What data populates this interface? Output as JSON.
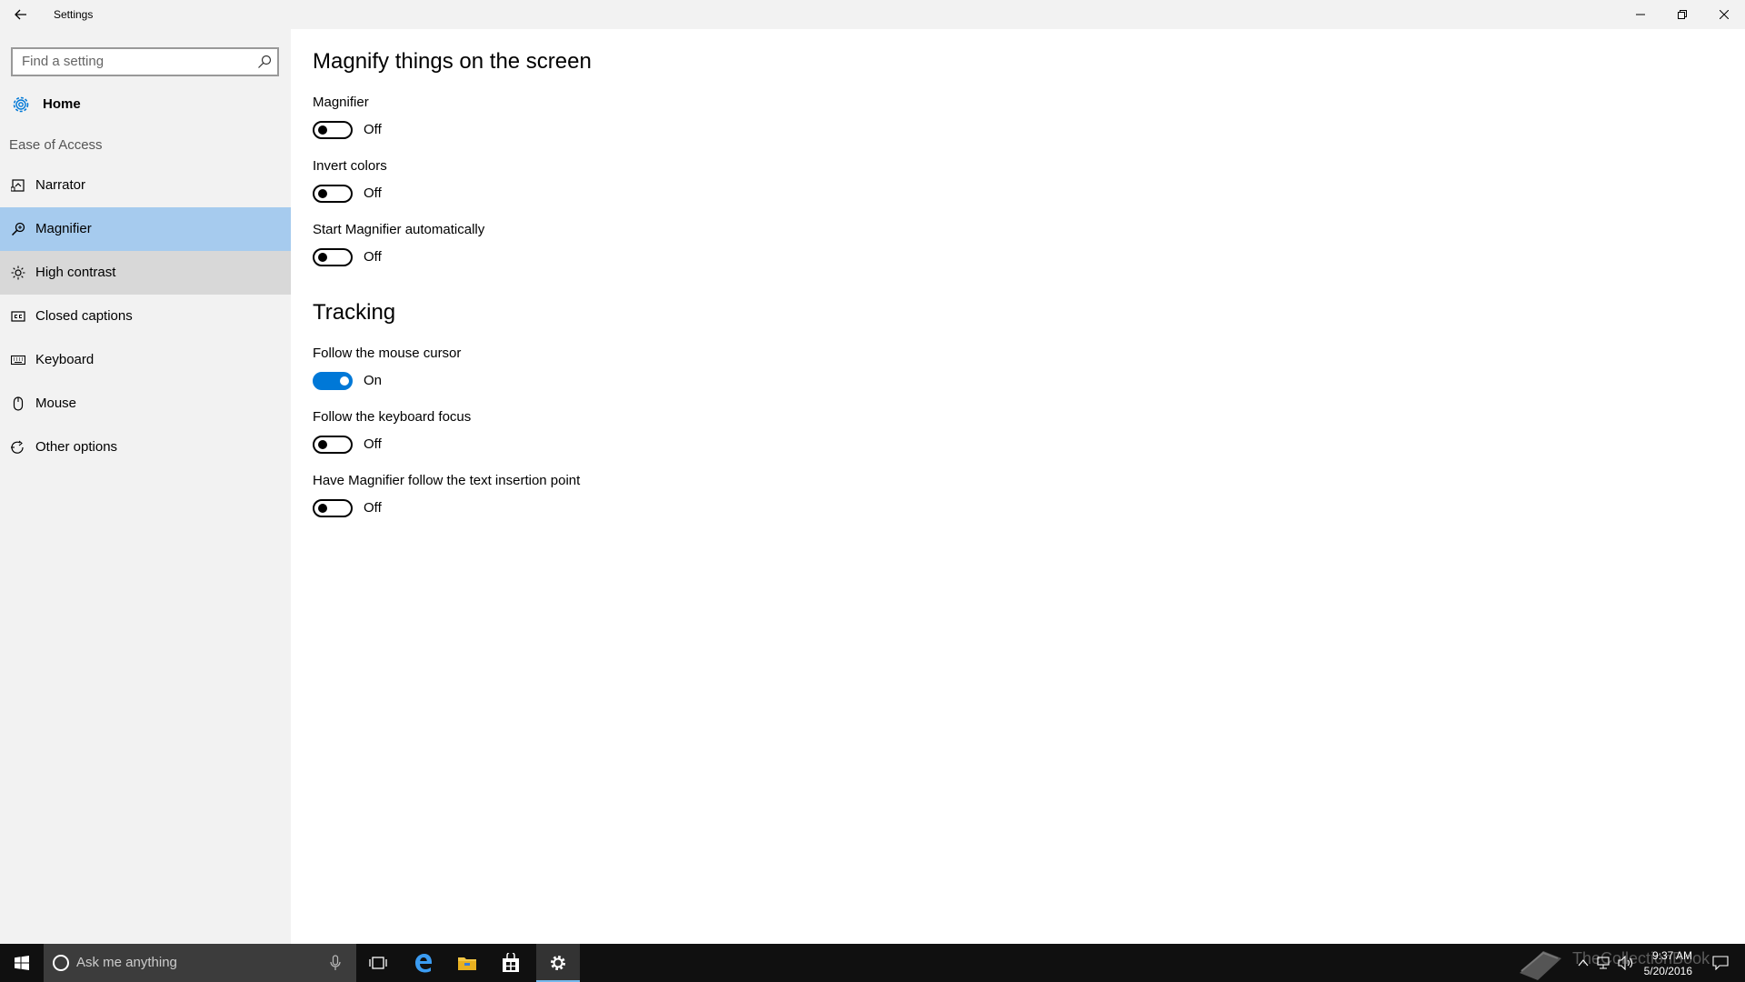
{
  "window": {
    "title": "Settings",
    "back_icon": "back-arrow-icon",
    "controls": [
      "minimize-icon",
      "restore-icon",
      "close-icon"
    ]
  },
  "sidebar": {
    "search": {
      "placeholder": "Find a setting",
      "icon": "search-icon"
    },
    "home": {
      "label": "Home",
      "icon": "gear-icon"
    },
    "group": "Ease of Access",
    "items": [
      {
        "label": "Narrator",
        "icon": "narrator-icon",
        "state": "normal"
      },
      {
        "label": "Magnifier",
        "icon": "magnifier-icon",
        "state": "selected"
      },
      {
        "label": "High contrast",
        "icon": "brightness-icon",
        "state": "hover"
      },
      {
        "label": "Closed captions",
        "icon": "closed-captions-icon",
        "state": "normal"
      },
      {
        "label": "Keyboard",
        "icon": "keyboard-icon",
        "state": "normal"
      },
      {
        "label": "Mouse",
        "icon": "mouse-icon",
        "state": "normal"
      },
      {
        "label": "Other options",
        "icon": "other-options-icon",
        "state": "normal"
      }
    ],
    "colors": {
      "selected_bg": "#a6cbee",
      "hover_bg": "#d8d8d8",
      "sidebar_bg": "#f2f2f2"
    }
  },
  "main": {
    "section1": {
      "heading": "Magnify things on the screen",
      "settings": [
        {
          "label": "Magnifier",
          "on": false,
          "state_text": "Off"
        },
        {
          "label": "Invert colors",
          "on": false,
          "state_text": "Off"
        },
        {
          "label": "Start Magnifier automatically",
          "on": false,
          "state_text": "Off"
        }
      ]
    },
    "section2": {
      "heading": "Tracking",
      "settings": [
        {
          "label": "Follow the mouse cursor",
          "on": true,
          "state_text": "On"
        },
        {
          "label": "Follow the keyboard focus",
          "on": false,
          "state_text": "Off"
        },
        {
          "label": "Have Magnifier follow the text insertion point",
          "on": false,
          "state_text": "Off"
        }
      ]
    },
    "accent_color": "#0078d7"
  },
  "taskbar": {
    "search_placeholder": "Ask me anything",
    "apps": [
      "task-view-icon",
      "edge-icon",
      "file-explorer-icon",
      "store-icon",
      "settings-icon"
    ],
    "active_app": "settings-icon",
    "watermark": "TheCollectionBook",
    "clock": {
      "time": "9:37 AM",
      "date": "5/20/2016"
    }
  }
}
